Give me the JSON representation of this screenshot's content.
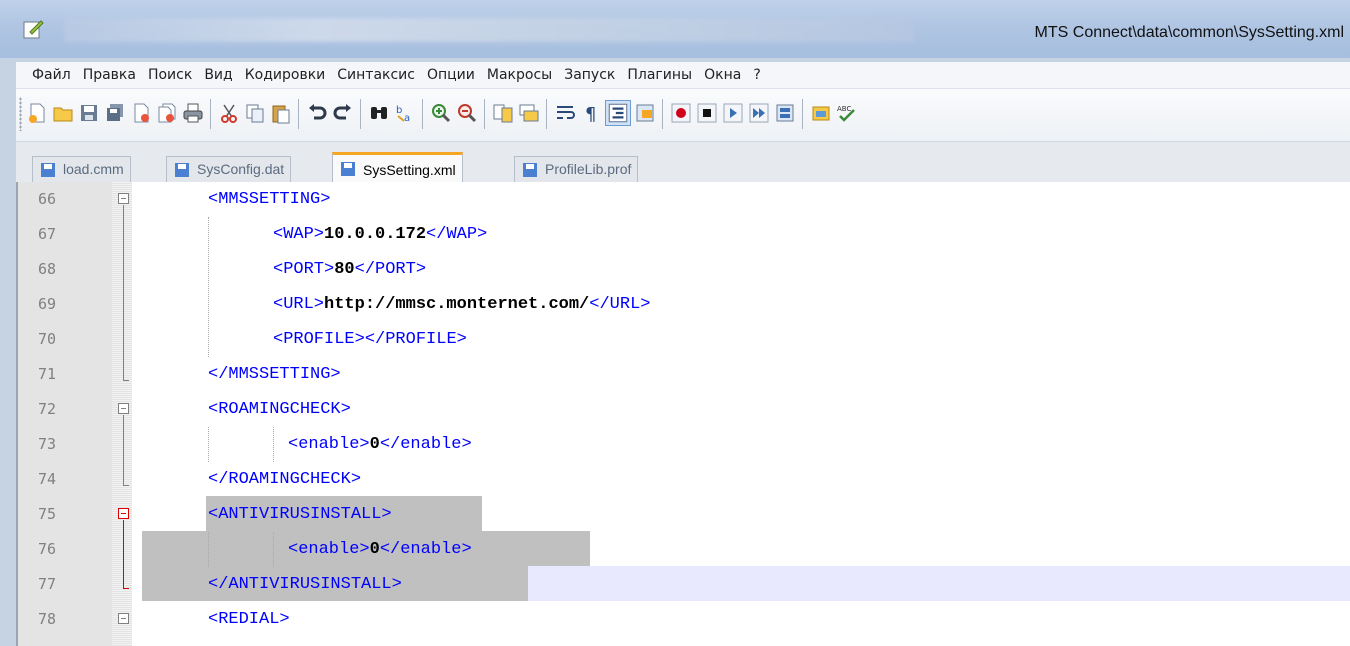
{
  "window": {
    "title": "MTS Connect\\data\\common\\SysSetting.xml"
  },
  "menu": {
    "items": [
      "Файл",
      "Правка",
      "Поиск",
      "Вид",
      "Кодировки",
      "Синтаксис",
      "Опции",
      "Макросы",
      "Запуск",
      "Плагины",
      "Окна",
      "?"
    ]
  },
  "toolbar": {
    "buttons": [
      "new-file-icon",
      "open-file-icon",
      "save-icon",
      "save-all-icon",
      "close-icon",
      "close-all-icon",
      "print-icon",
      "cut-icon",
      "copy-icon",
      "paste-icon",
      "undo-icon",
      "redo-icon",
      "find-icon",
      "replace-icon",
      "zoom-in-icon",
      "zoom-out-icon",
      "sync-vertical-icon",
      "sync-horizontal-icon",
      "word-wrap-icon",
      "show-all-chars-icon",
      "indent-guide-icon",
      "doc-map-icon",
      "record-macro-icon",
      "stop-record-icon",
      "play-macro-icon",
      "run-macro-multiple-icon",
      "save-macro-icon",
      "file-browser-icon",
      "spellcheck-icon"
    ]
  },
  "tabs": [
    {
      "label": "load.cmm",
      "active": false
    },
    {
      "label": "SysConfig.dat",
      "active": false
    },
    {
      "label": "SysSetting.xml",
      "active": true
    },
    {
      "label": "ProfileLib.prof",
      "active": false
    }
  ],
  "editor": {
    "lines": [
      {
        "num": "66",
        "open": "<MMSSETTING>",
        "value": "",
        "close": ""
      },
      {
        "num": "67",
        "open": "<WAP>",
        "value": "10.0.0.172",
        "close": "</WAP>"
      },
      {
        "num": "68",
        "open": "<PORT>",
        "value": "80",
        "close": "</PORT>"
      },
      {
        "num": "69",
        "open": "<URL>",
        "value": "http://mmsc.monternet.com/",
        "close": "</URL>"
      },
      {
        "num": "70",
        "open": "<PROFILE>",
        "value": "",
        "close": "</PROFILE>"
      },
      {
        "num": "71",
        "open": "</MMSSETTING>",
        "value": "",
        "close": ""
      },
      {
        "num": "72",
        "open": "<ROAMINGCHECK>",
        "value": "",
        "close": ""
      },
      {
        "num": "73",
        "open": "<enable>",
        "value": "0",
        "close": "</enable>"
      },
      {
        "num": "74",
        "open": "</ROAMINGCHECK>",
        "value": "",
        "close": ""
      },
      {
        "num": "75",
        "open": "<ANTIVIRUSINSTALL>",
        "value": "",
        "close": ""
      },
      {
        "num": "76",
        "open": "<enable>",
        "value": "0",
        "close": "</enable>"
      },
      {
        "num": "77",
        "open": "</ANTIVIRUSINSTALL>",
        "value": "",
        "close": ""
      },
      {
        "num": "78",
        "open": "<REDIAL>",
        "value": "",
        "close": ""
      }
    ]
  },
  "colors": {
    "tag": "#0000ff",
    "value": "#000000",
    "selection": "#c0c0c0",
    "current_line": "#e8e8ff",
    "active_tab_accent": "#f5a623",
    "fold_highlight": "#e00000"
  }
}
